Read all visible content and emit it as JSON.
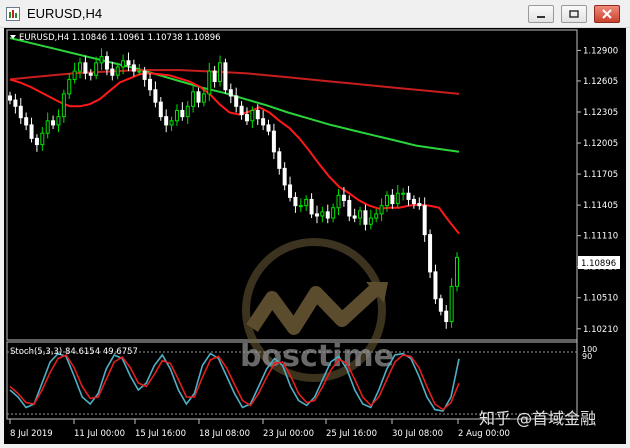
{
  "window": {
    "title": "EURUSD,H4"
  },
  "chart": {
    "header": "EURUSD,H4  1.10846 1.10961 1.10738 1.10896",
    "price_axis_labels": [
      "1.12900",
      "1.12605",
      "1.12305",
      "1.12005",
      "1.11705",
      "1.11405",
      "1.11110",
      "1.10810",
      "1.10510",
      "1.10210"
    ],
    "current_price": "1.10896",
    "time_labels": [
      "8 Jul 2019",
      "11 Jul 00:00",
      "15 Jul 16:00",
      "18 Jul 08:00",
      "23 Jul 00:00",
      "25 Jul 16:00",
      "30 Jul 08:00",
      "2 Aug 00:00"
    ],
    "stoch_header": "Stoch(5,3,3) 84.6154 49.6757",
    "stoch_axis_labels": [
      "100",
      "90"
    ],
    "watermark_text": "bosctime",
    "corner_watermark": "知乎 @首域金融",
    "colors": {
      "bull": "#00e000",
      "bear": "#ffffff",
      "ma_fast": "#ff1a1a",
      "ma_mid": "#c81e1e",
      "ma_slow": "#2ad43a",
      "stoch_main": "#4fb0c6",
      "stoch_signal": "#e02020"
    }
  },
  "chart_data": {
    "type": "candlestick",
    "symbol": "EURUSD",
    "timeframe": "H4",
    "ylim": [
      1.1015,
      1.1302
    ],
    "x": [
      "8 Jul 2019",
      "11 Jul 00:00",
      "15 Jul 16:00",
      "18 Jul 08:00",
      "23 Jul 00:00",
      "25 Jul 16:00",
      "30 Jul 08:00",
      "2 Aug 00:00"
    ],
    "close": [
      1.1242,
      1.1236,
      1.1225,
      1.1218,
      1.1205,
      1.1199,
      1.121,
      1.1222,
      1.1218,
      1.1226,
      1.1248,
      1.1262,
      1.127,
      1.1278,
      1.1268,
      1.1266,
      1.1278,
      1.1284,
      1.1272,
      1.1266,
      1.1274,
      1.128,
      1.1276,
      1.127,
      1.127,
      1.1262,
      1.1252,
      1.124,
      1.1226,
      1.1218,
      1.1222,
      1.1232,
      1.1226,
      1.1236,
      1.125,
      1.124,
      1.1248,
      1.127,
      1.126,
      1.1278,
      1.1252,
      1.1246,
      1.1236,
      1.1228,
      1.1222,
      1.1232,
      1.1224,
      1.1218,
      1.1212,
      1.1192,
      1.1176,
      1.116,
      1.1148,
      1.114,
      1.114,
      1.1146,
      1.1132,
      1.113,
      1.1134,
      1.1128,
      1.1138,
      1.115,
      1.1145,
      1.113,
      1.1128,
      1.1135,
      1.1122,
      1.1128,
      1.1132,
      1.114,
      1.115,
      1.1142,
      1.1152,
      1.1152,
      1.1146,
      1.1142,
      1.114,
      1.1112,
      1.1076,
      1.105,
      1.1038,
      1.1028,
      1.1062,
      1.109
    ],
    "ma_fast": [
      1.1262,
      1.1259,
      1.1255,
      1.125,
      1.1245,
      1.124,
      1.1236,
      1.1236,
      1.1238,
      1.1243,
      1.1251,
      1.1259,
      1.1263,
      1.1267,
      1.1268,
      1.1267,
      1.1266,
      1.1263,
      1.126,
      1.1255,
      1.1248,
      1.1238,
      1.123,
      1.1228,
      1.1231,
      1.1235,
      1.123,
      1.1222,
      1.1215,
      1.1205,
      1.1193,
      1.118,
      1.1168,
      1.1158,
      1.1152,
      1.1145,
      1.114,
      1.1137,
      1.1138,
      1.1138,
      1.114,
      1.1141,
      1.114,
      1.1138,
      1.1125,
      1.1113
    ],
    "ma_mid": [
      1.1262,
      1.1264,
      1.1266,
      1.1268,
      1.1269,
      1.127,
      1.1271,
      1.1271,
      1.1271,
      1.127,
      1.1269,
      1.1268,
      1.1266,
      1.1264,
      1.1262,
      1.126,
      1.1258,
      1.1256,
      1.1254,
      1.1252,
      1.125,
      1.1248
    ],
    "ma_slow": [
      1.1302,
      1.1297,
      1.1292,
      1.1287,
      1.1282,
      1.1277,
      1.1272,
      1.1266,
      1.126,
      1.1254,
      1.1249,
      1.1243,
      1.1237,
      1.123,
      1.1224,
      1.1218,
      1.1213,
      1.1208,
      1.1203,
      1.1198,
      1.1195,
      1.1192
    ],
    "stochastic": {
      "main": [
        40,
        30,
        15,
        20,
        50,
        80,
        92,
        88,
        60,
        30,
        20,
        35,
        70,
        90,
        85,
        60,
        40,
        50,
        75,
        90,
        70,
        40,
        20,
        35,
        75,
        92,
        85,
        60,
        35,
        15,
        20,
        45,
        70,
        85,
        75,
        45,
        25,
        18,
        30,
        55,
        80,
        88,
        70,
        40,
        20,
        15,
        40,
        70,
        90,
        92,
        85,
        60,
        30,
        12,
        10,
        30,
        84.6
      ],
      "signal": [
        45,
        35,
        22,
        20,
        40,
        65,
        85,
        90,
        72,
        45,
        28,
        30,
        55,
        80,
        87,
        72,
        50,
        45,
        62,
        82,
        78,
        55,
        30,
        30,
        58,
        83,
        88,
        72,
        48,
        25,
        18,
        35,
        58,
        78,
        80,
        60,
        35,
        22,
        25,
        45,
        68,
        84,
        78,
        55,
        30,
        18,
        30,
        55,
        80,
        90,
        88,
        72,
        45,
        20,
        12,
        22,
        49.7
      ]
    }
  }
}
